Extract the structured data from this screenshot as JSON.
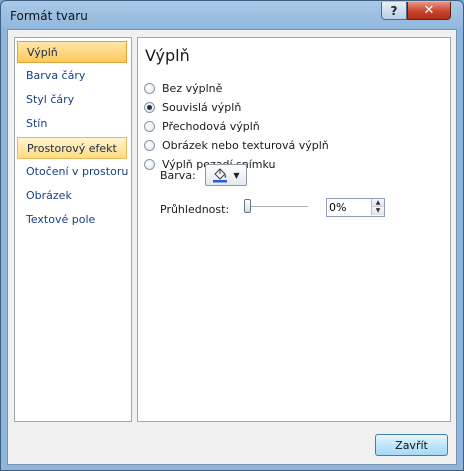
{
  "window": {
    "title": "Formát tvaru",
    "help_label": "?",
    "close_label": "✕"
  },
  "sidebar": {
    "items": [
      {
        "label": "Výplň",
        "state": "selected"
      },
      {
        "label": "Barva čáry",
        "state": "normal"
      },
      {
        "label": "Styl čáry",
        "state": "normal"
      },
      {
        "label": "Stín",
        "state": "normal"
      },
      {
        "label": "Prostorový efekt",
        "state": "hover"
      },
      {
        "label": "Otočení v prostoru",
        "state": "normal"
      },
      {
        "label": "Obrázek",
        "state": "normal"
      },
      {
        "label": "Textové pole",
        "state": "normal"
      }
    ]
  },
  "panel": {
    "title": "Výplň",
    "fill_options": [
      {
        "label": "Bez výplně",
        "checked": false
      },
      {
        "label": "Souvislá výplň",
        "checked": true
      },
      {
        "label": "Přechodová výplň",
        "checked": false
      },
      {
        "label": "Obrázek nebo texturová výplň",
        "checked": false
      },
      {
        "label": "Výplň pozadí snímku",
        "checked": false
      }
    ],
    "color_label": "Barva:",
    "color_button_icon": "paint-bucket-icon",
    "color_button_arrow": "▼",
    "transparency_label": "Průhlednost:",
    "transparency_value": "0%",
    "transparency_slider_fraction": 0,
    "spin_up": "▲",
    "spin_down": "▼"
  },
  "footer": {
    "close_button_label": "Zavřít"
  },
  "colors": {
    "selected_item": "#fbc95a",
    "hover_item": "#ffdb83",
    "nav_text": "#1b3f84",
    "close_btn": "#c8432b",
    "bucket_fill": "#2a5bd7"
  }
}
